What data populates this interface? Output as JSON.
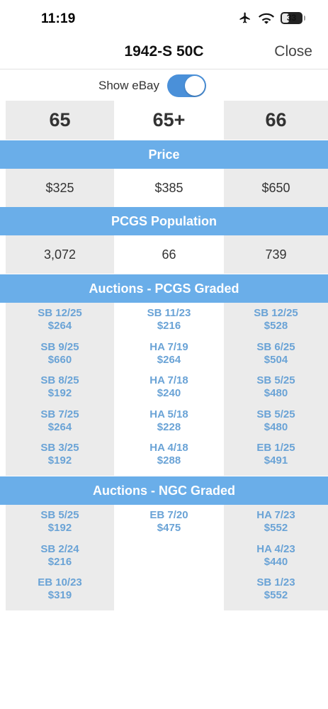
{
  "status_bar": {
    "time": "11:19",
    "battery": "33",
    "icons": [
      "airplane-icon",
      "wifi-icon",
      "battery-icon"
    ]
  },
  "nav": {
    "title": "1942-S 50C",
    "close_label": "Close"
  },
  "toggle": {
    "label": "Show eBay",
    "on": true
  },
  "grades": [
    "65",
    "65+",
    "66"
  ],
  "sections": {
    "price": {
      "title": "Price",
      "values": [
        "$325",
        "$385",
        "$650"
      ]
    },
    "population": {
      "title": "PCGS Population",
      "values": [
        "3,072",
        "66",
        "739"
      ]
    },
    "pcgs_auctions": {
      "title": "Auctions - PCGS Graded",
      "columns": [
        [
          {
            "source": "SB 12/25",
            "price": "$264"
          },
          {
            "source": "SB 9/25",
            "price": "$660"
          },
          {
            "source": "SB 8/25",
            "price": "$192"
          },
          {
            "source": "SB 7/25",
            "price": "$264"
          },
          {
            "source": "SB 3/25",
            "price": "$192"
          }
        ],
        [
          {
            "source": "SB 11/23",
            "price": "$216"
          },
          {
            "source": "HA 7/19",
            "price": "$264"
          },
          {
            "source": "HA 7/18",
            "price": "$240"
          },
          {
            "source": "HA 5/18",
            "price": "$228"
          },
          {
            "source": "HA 4/18",
            "price": "$288"
          }
        ],
        [
          {
            "source": "SB 12/25",
            "price": "$528"
          },
          {
            "source": "SB 6/25",
            "price": "$504"
          },
          {
            "source": "SB 5/25",
            "price": "$480"
          },
          {
            "source": "SB 5/25",
            "price": "$480"
          },
          {
            "source": "EB 1/25",
            "price": "$491"
          }
        ]
      ]
    },
    "ngc_auctions": {
      "title": "Auctions - NGC Graded",
      "columns": [
        [
          {
            "source": "SB 5/25",
            "price": "$192"
          },
          {
            "source": "SB 2/24",
            "price": "$216"
          },
          {
            "source": "EB 10/23",
            "price": "$319"
          }
        ],
        [
          {
            "source": "EB 7/20",
            "price": "$475"
          }
        ],
        [
          {
            "source": "HA 7/23",
            "price": "$552"
          },
          {
            "source": "HA 4/23",
            "price": "$440"
          },
          {
            "source": "SB 1/23",
            "price": "$552"
          }
        ]
      ]
    }
  },
  "colors": {
    "accent": "#6aaee9",
    "toggle_on": "#4a90d9",
    "link_text": "#6aa3d6",
    "gray_column": "#ebebeb"
  }
}
